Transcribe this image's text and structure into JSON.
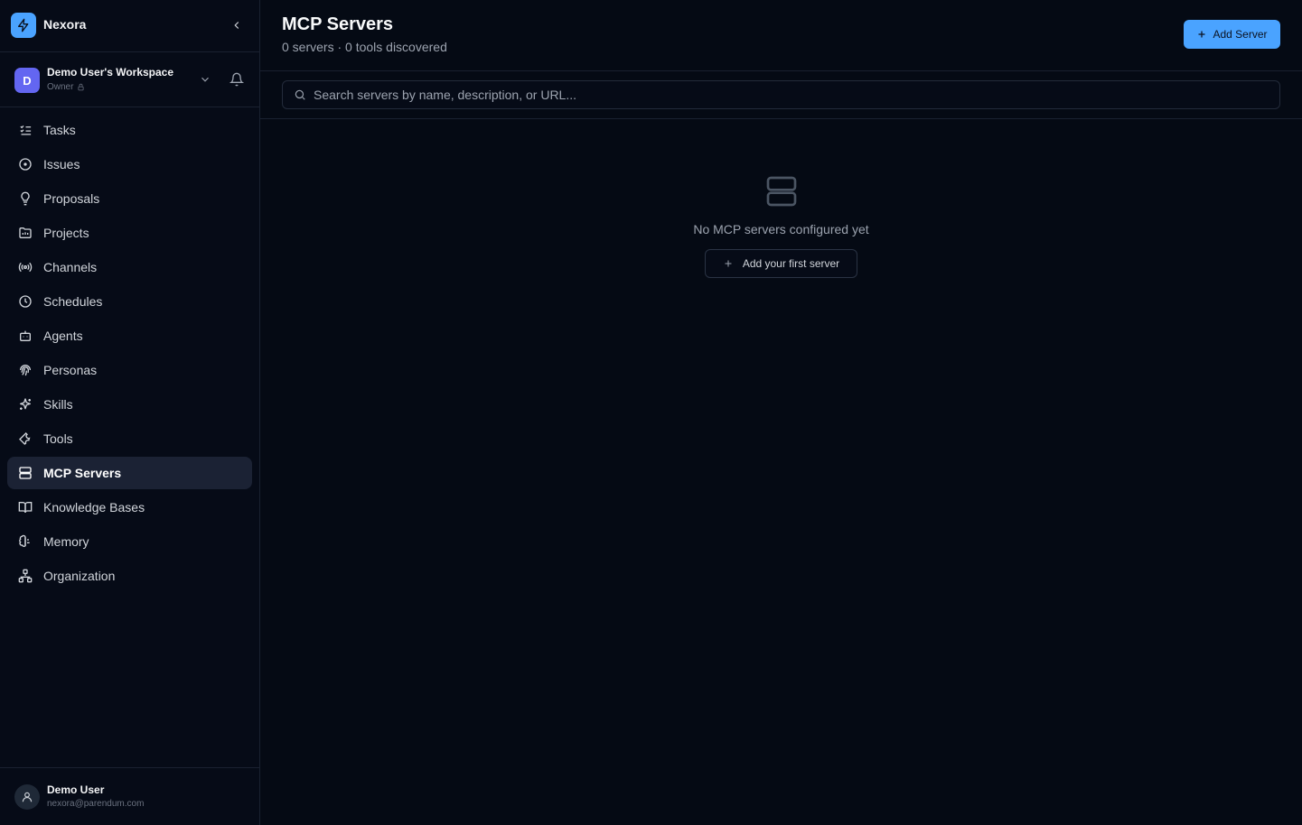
{
  "brand": {
    "name": "Nexora",
    "accent": "#4aa3ff"
  },
  "workspace": {
    "initial": "D",
    "name": "Demo User's Workspace",
    "role": "Owner"
  },
  "nav": {
    "items": [
      {
        "label": "Tasks",
        "icon": "tasks-icon"
      },
      {
        "label": "Issues",
        "icon": "issues-icon"
      },
      {
        "label": "Proposals",
        "icon": "lightbulb-icon"
      },
      {
        "label": "Projects",
        "icon": "folder-icon"
      },
      {
        "label": "Channels",
        "icon": "broadcast-icon"
      },
      {
        "label": "Schedules",
        "icon": "clock-icon"
      },
      {
        "label": "Agents",
        "icon": "bot-icon"
      },
      {
        "label": "Personas",
        "icon": "fingerprint-icon"
      },
      {
        "label": "Skills",
        "icon": "sparkles-icon"
      },
      {
        "label": "Tools",
        "icon": "wrench-icon"
      },
      {
        "label": "MCP Servers",
        "icon": "server-icon",
        "active": true
      },
      {
        "label": "Knowledge Bases",
        "icon": "book-icon"
      },
      {
        "label": "Memory",
        "icon": "brain-icon"
      },
      {
        "label": "Organization",
        "icon": "org-chart-icon"
      }
    ]
  },
  "user": {
    "name": "Demo User",
    "email": "nexora@parendum.com"
  },
  "header": {
    "title": "MCP Servers",
    "subtitle": "0 servers · 0 tools discovered",
    "add_button": "Add Server"
  },
  "search": {
    "placeholder": "Search servers by name, description, or URL..."
  },
  "empty_state": {
    "message": "No MCP servers configured yet",
    "button": "Add your first server"
  }
}
